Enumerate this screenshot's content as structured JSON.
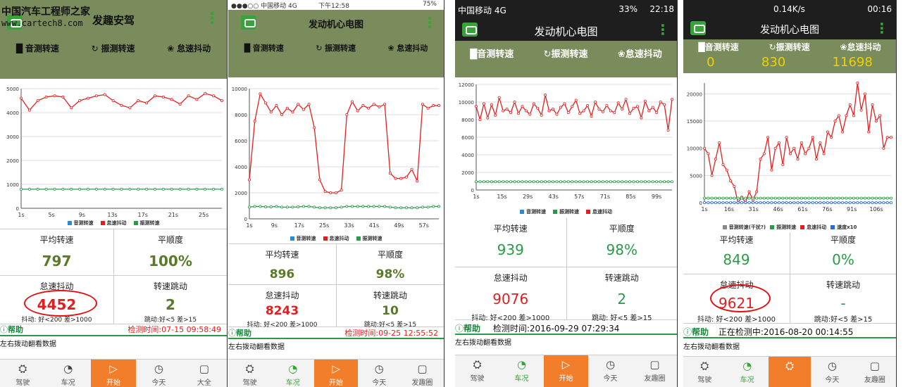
{
  "watermark": {
    "line1": "中国汽车工程师之家",
    "line2": "www.cartech8.com"
  },
  "colors": {
    "red": "#e02020",
    "green": "#2a9a4a",
    "blue": "#2a8ad8",
    "olive": "#7a8b5c",
    "orange": "#f27d2a"
  },
  "phones": [
    {
      "title": "发趣安驾",
      "tabs": [
        "音测转速",
        "振测转速",
        "怠速抖动"
      ],
      "legend": [
        "音测转速",
        "怠速抖动",
        "振测转速"
      ],
      "stats": {
        "avg_label": "平均转速",
        "avg_value": "797",
        "smooth_label": "平顺度",
        "smooth_value": "100%",
        "idle_label": "怠速抖动",
        "idle_value": "4452",
        "jump_label": "转速跳动",
        "jump_value": "2",
        "idle_sub": "抖动: 好<200 差>1000",
        "jump_sub": "跳动:好<5 差>15"
      },
      "help": "帮助",
      "time": "检测时间:07-15 09:58:49",
      "swipe": "左右拨动翻看数据",
      "nav": [
        "驾驶",
        "车况",
        "开始",
        "今天",
        "大全"
      ],
      "chart_data": {
        "type": "line",
        "x": [
          "1s",
          "5s",
          "9s",
          "13s",
          "17s",
          "21s",
          "25s"
        ],
        "yticks": [
          "0",
          "1000",
          "2000",
          "3000",
          "4000",
          "5000"
        ],
        "ylim": [
          0,
          5000
        ],
        "series": [
          {
            "name": "怠速抖动",
            "values": [
              4600,
              4100,
              4500,
              4650,
              4700,
              4650,
              4200,
              4500,
              4600,
              4700,
              4750,
              4500,
              4300,
              4200,
              4500,
              4400,
              4700,
              4650,
              4550,
              4350,
              4700,
              4550,
              4800,
              4700,
              4500
            ]
          },
          {
            "name": "振测转速",
            "values": [
              797,
              797,
              797,
              797,
              797,
              797,
              797,
              797,
              797,
              797,
              797,
              797,
              797,
              797,
              797,
              797,
              797,
              797,
              797,
              797,
              797,
              797,
              797,
              797,
              797
            ]
          }
        ]
      }
    },
    {
      "status_carrier": "●●●○○ 中国移动 4G",
      "status_time": "下午12:58",
      "status_bat": "75%",
      "title": "发动机心电图",
      "tabs": [
        "音测转速",
        "振测转速",
        "怠速抖动"
      ],
      "legend": [
        "音测转速",
        "怠速抖动",
        "振测转速"
      ],
      "stats": {
        "avg_label": "平均转速",
        "avg_value": "896",
        "smooth_label": "平顺度",
        "smooth_value": "98%",
        "idle_label": "怠速抖动",
        "idle_value": "8243",
        "jump_label": "转速跳动",
        "jump_value": "10",
        "idle_sub": "抖动: 好<200 差>1000",
        "jump_sub": "跳动:好<5 差>15"
      },
      "help": "帮助",
      "time": "检测时间:09-25 12:55:52",
      "swipe": "左右拨动翻看数据",
      "nav": [
        "驾驶",
        "车况",
        "开始",
        "今天",
        "发趣圈"
      ],
      "chart_data": {
        "type": "line",
        "x": [
          "1s",
          "9s",
          "17s",
          "25s",
          "33s",
          "41s",
          "49s",
          "57s"
        ],
        "yticks": [
          "0",
          "2000",
          "4000",
          "6000",
          "8000",
          "10000"
        ],
        "ylim": [
          0,
          10000
        ],
        "series": [
          {
            "name": "怠速抖动",
            "values": [
              3000,
              7500,
              9600,
              8900,
              8200,
              8700,
              8000,
              8500,
              8200,
              8800,
              8400,
              8800,
              7000,
              3000,
              2100,
              2000,
              2000,
              2200,
              8000,
              9000,
              8300,
              8700,
              8500,
              8800,
              8600,
              8800,
              3500,
              3100,
              3100,
              3200,
              3800,
              2900,
              8800,
              8500,
              8700,
              8700
            ]
          },
          {
            "name": "振测转速",
            "values": [
              900,
              950,
              950,
              920,
              920,
              950,
              900,
              900,
              900,
              920,
              950,
              950,
              900,
              850,
              850,
              850,
              850,
              900,
              950,
              950,
              950,
              950,
              950,
              950,
              950,
              950,
              900,
              850,
              850,
              850,
              850,
              850,
              900,
              900,
              950,
              950
            ]
          }
        ]
      }
    },
    {
      "status_carrier": "中国移动 4G",
      "status_right": "33%",
      "status_time": "22:18",
      "title": "发动机心电图",
      "tabs": [
        "音测转速",
        "振测转速",
        "怠速抖动"
      ],
      "legend": [
        "音测转速",
        "振测转速",
        "怠速抖动"
      ],
      "stats": {
        "avg_label": "平均转速",
        "avg_value": "939",
        "smooth_label": "平顺度",
        "smooth_value": "98%",
        "idle_label": "怠速抖动",
        "idle_value": "9076",
        "jump_label": "转速跳动",
        "jump_value": "2",
        "idle_sub": "抖动: 好<200 差>1000",
        "jump_sub": "跳动: 好<5 差>15"
      },
      "help": "帮助",
      "time": "检测时间:2016-09-29 07:29:34",
      "swipe": "左右拨动翻看数据",
      "nav": [
        "驾驶",
        "车况",
        "开始",
        "今天",
        "友趣圈"
      ],
      "chart_data": {
        "type": "line",
        "x": [
          "1s",
          "15s",
          "29s",
          "43s",
          "57s",
          "71s",
          "85s",
          "99s"
        ],
        "yticks": [
          "0",
          "2000",
          "4000",
          "6000",
          "8000",
          "10000",
          "12000"
        ],
        "ylim": [
          0,
          12000
        ],
        "series": [
          {
            "name": "怠速抖动",
            "values": [
              9500,
              8000,
              9800,
              8200,
              9700,
              8500,
              10500,
              9000,
              9200,
              8800,
              10000,
              8700,
              9500,
              9000,
              8600,
              9800,
              9300,
              8500,
              10800,
              9000,
              9200,
              8600,
              9400,
              9800,
              8800,
              9500,
              10200,
              8700,
              9000,
              9600,
              8400,
              10000,
              9200,
              8900,
              9600,
              9000,
              8800,
              9900,
              9200,
              10300,
              8700,
              9300,
              9500,
              8200,
              10100,
              9000,
              9400,
              8800,
              10000,
              9700,
              6800,
              10300
            ]
          },
          {
            "name": "振测转速",
            "values": [
              939,
              939,
              939,
              939,
              939,
              939,
              939,
              939,
              939,
              939,
              939,
              939,
              939,
              939,
              939,
              939,
              939,
              939,
              939,
              939,
              939,
              939,
              939,
              939,
              939,
              939,
              939,
              939,
              939,
              939,
              939,
              939,
              939,
              939,
              939,
              939,
              939,
              939,
              939,
              939,
              939,
              939,
              939,
              939,
              939,
              939,
              939,
              939,
              939,
              939,
              939,
              939
            ]
          }
        ]
      }
    },
    {
      "status_right": "0.14K/s",
      "status_time": "00:16",
      "title": "发动机心电图",
      "tabs": [
        "音测转速",
        "振测转速",
        "怠速抖动"
      ],
      "metric_vals": [
        "0",
        "830",
        "11698"
      ],
      "legend": [
        "音测转速(干扰?)",
        "振测转速",
        "怠速抖动",
        "速度x10"
      ],
      "stats": {
        "avg_label": "平均转速",
        "avg_value": "849",
        "smooth_label": "平顺度",
        "smooth_value": "0%",
        "idle_label": "怠速抖动",
        "idle_value": "9621",
        "jump_label": "转速跳动",
        "jump_value": "-",
        "idle_sub": "抖动: 好<200 差>1000",
        "jump_sub": "跳动:好<5 差>15"
      },
      "help": "帮助",
      "time": "正在检测中:2016-08-20 00:14:55",
      "swipe": "左右拨动翻看数据",
      "nav": [
        "驾驶",
        "车况",
        "",
        "今天",
        "友趣圈"
      ],
      "chart_data": {
        "type": "line",
        "x": [
          "1s",
          "16s",
          "31s",
          "46s",
          "61s",
          "76s",
          "91s",
          "106s"
        ],
        "yticks": [
          "0",
          "5000",
          "10000",
          "15000",
          "20000"
        ],
        "ylim": [
          0,
          22000
        ],
        "series": [
          {
            "name": "怠速抖动",
            "values": [
              10000,
              9000,
              5000,
              8000,
              11000,
              7000,
              6000,
              4000,
              3000,
              0,
              1000,
              0,
              2000,
              500,
              2000,
              8000,
              9000,
              12000,
              6000,
              10000,
              11000,
              7000,
              12000,
              9000,
              10000,
              8000,
              11000,
              9000,
              10000,
              12000,
              8000,
              11000,
              9000,
              13000,
              12000,
              15000,
              16000,
              13000,
              16000,
              18000,
              16000,
              22000,
              17000,
              20000,
              13000,
              18000,
              15000,
              16000,
              10000,
              12000,
              12000
            ]
          },
          {
            "name": "振测转速",
            "values": [
              830,
              830,
              830,
              830,
              830,
              830,
              830,
              830,
              830,
              830,
              830,
              830,
              830,
              830,
              830,
              830,
              830,
              830,
              830,
              830,
              830,
              830,
              830,
              830,
              830,
              830,
              830,
              830,
              830,
              830,
              830,
              830,
              830,
              830,
              830,
              830,
              830,
              830,
              830,
              830,
              830,
              830,
              830,
              830,
              830,
              830,
              830,
              830,
              830,
              830,
              830
            ]
          },
          {
            "name": "速度x10",
            "values": [
              0,
              0,
              0,
              0,
              0,
              0,
              0,
              0,
              0,
              0,
              0,
              0,
              0,
              0,
              0,
              0,
              0,
              0,
              0,
              0,
              0,
              0,
              0,
              0,
              0,
              0,
              0,
              0,
              0,
              0,
              0,
              0,
              0,
              0,
              0,
              0,
              0,
              0,
              0,
              0,
              0,
              0,
              0,
              0,
              0,
              0,
              0,
              0,
              0,
              0,
              0
            ]
          }
        ]
      }
    }
  ]
}
